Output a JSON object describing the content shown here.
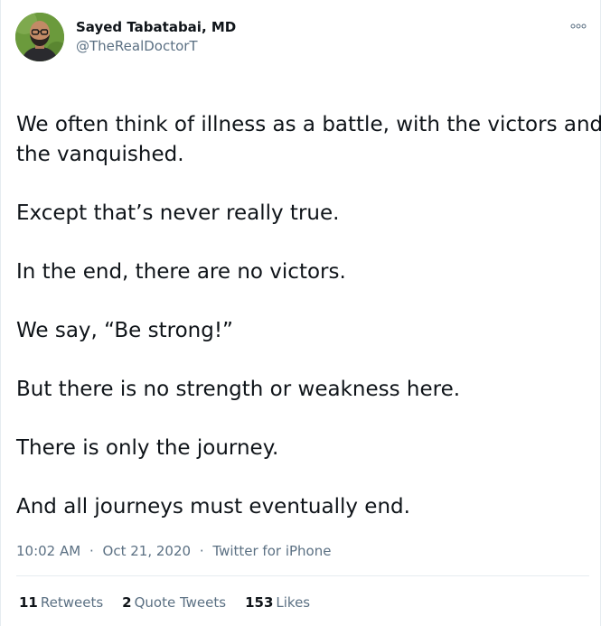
{
  "author": {
    "name": "Sayed Tabatabai, MD",
    "handle": "@TheRealDoctorT",
    "avatar_icon": "profile-photo"
  },
  "header": {
    "more_icon": "more-options-icon"
  },
  "tweet": {
    "lines": [
      "We often think of illness as a battle, with the victors and",
      "the vanquished.",
      "Except that’s never really true.",
      "In the end, there are no victors.",
      "We say, “Be strong!”",
      "But there is no strength or weakness here.",
      "There is only the journey.",
      "And all journeys must eventually end."
    ]
  },
  "meta": {
    "time": "10:02 AM",
    "separator": "·",
    "date": "Oct 21, 2020",
    "source": "Twitter for iPhone"
  },
  "stats": {
    "retweets_count": "11",
    "retweets_label": "Retweets",
    "quotes_count": "2",
    "quotes_label": "Quote Tweets",
    "likes_count": "153",
    "likes_label": "Likes"
  },
  "colors": {
    "text_primary": "#0f1419",
    "text_secondary": "#5b7083",
    "border": "#e6ecf0"
  }
}
